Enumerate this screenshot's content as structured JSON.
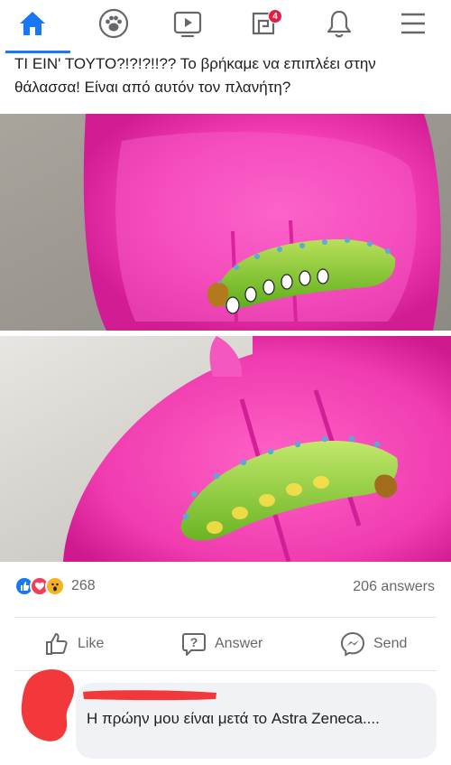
{
  "nav": {
    "items": [
      {
        "name": "home"
      },
      {
        "name": "groups"
      },
      {
        "name": "watch"
      },
      {
        "name": "notifications-pages",
        "badge": "4"
      },
      {
        "name": "notifications"
      },
      {
        "name": "menu"
      }
    ],
    "active_color": "#1877f2",
    "badge_color": "#e41e3f"
  },
  "post": {
    "text": "ΤΙ ΕΙΝ' ΤΟΥΤΟ?!?!?!!?? Το βρήκαμε να επιπλέει στην θάλασσα! Είναι από αυτόν τον πλανήτη?",
    "photos": [
      {
        "subject": "green caterpillar in pink scoop"
      },
      {
        "subject": "green caterpillar in pink scoop"
      }
    ]
  },
  "stats": {
    "reaction_icons": [
      "like-icon",
      "love-icon",
      "wow-icon"
    ],
    "reaction_count": "268",
    "answers": "206 answers"
  },
  "actions": {
    "like": "Like",
    "answer": "Answer",
    "send": "Send"
  },
  "comment": {
    "text": "Η πρώην μου είναι μετά το Astra Zeneca...."
  },
  "colors": {
    "accent": "#1877f2",
    "muted": "#65676b",
    "bubble": "#f0f2f5",
    "redaction": "#f2383a"
  }
}
